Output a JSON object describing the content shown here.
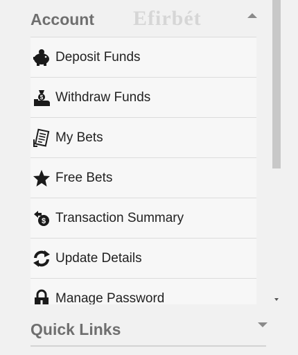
{
  "account": {
    "title": "Account",
    "brand_watermark": "Efirbét"
  },
  "menu": {
    "items": [
      {
        "label": "Deposit Funds",
        "icon": "piggy-bank-icon"
      },
      {
        "label": "Withdraw Funds",
        "icon": "money-hand-icon"
      },
      {
        "label": "My Bets",
        "icon": "bet-slip-icon"
      },
      {
        "label": "Free Bets",
        "icon": "star-icon"
      },
      {
        "label": "Transaction Summary",
        "icon": "dollar-exchange-icon"
      },
      {
        "label": "Update Details",
        "icon": "refresh-icon"
      },
      {
        "label": "Manage Password",
        "icon": "lock-icon"
      }
    ]
  },
  "quick_links": {
    "title": "Quick Links"
  }
}
